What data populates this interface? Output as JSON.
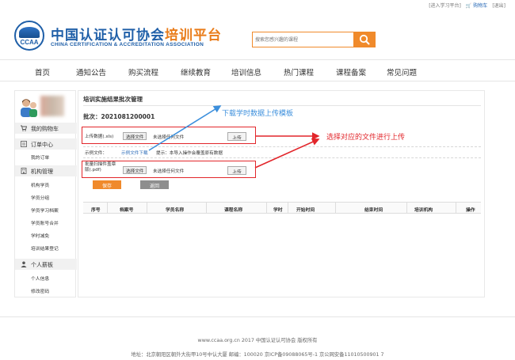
{
  "topbar": {
    "enter_learning": "[进入学习平台]",
    "cart": "购物车",
    "logout": "[退出]"
  },
  "header": {
    "logo_text": "CCAA",
    "brand_cn_main": "中国认证认可协会",
    "brand_cn_accent": "培训平台",
    "brand_en": "CHINA CERTIFICATION & ACCREDITATION ASSOCIATION",
    "search_placeholder": "搜索您感兴趣的课程"
  },
  "nav": [
    "首页",
    "通知公告",
    "购买流程",
    "继续教育",
    "培训信息",
    "热门课程",
    "课程备案",
    "常见问题"
  ],
  "sidebar": {
    "sections": [
      {
        "title": "我的购物车",
        "icon": "cart-icon",
        "items": []
      },
      {
        "title": "订单中心",
        "icon": "list-icon",
        "items": [
          "我的订单"
        ]
      },
      {
        "title": "机构管理",
        "icon": "building-icon",
        "items": [
          "机构学员",
          "学员分组",
          "学员学习档案",
          "学员账号合并",
          "学时减免",
          "培训结果登记"
        ]
      },
      {
        "title": "个人薪板",
        "icon": "person-icon",
        "items": [
          "个人信息",
          "修改密码"
        ]
      }
    ]
  },
  "main": {
    "page_title": "培训实施结果批次管理",
    "batch": "批次：2021081200001",
    "upload_data_label": "上传数据(.xls)",
    "choose_file": "选择文件",
    "no_file": "未选择任何文件",
    "upload": "上传",
    "sample_label": "示例文件：",
    "sample_link": "示例文件下载",
    "tip": "提示：本导入操作会覆盖原有数据",
    "stamp_label_1": "批量扫描件盖章",
    "stamp_label_2": "版(.pdf)",
    "save": "保存",
    "back": "返回",
    "table_headers": [
      "序号",
      "档案号",
      "学员名称",
      "课程名称",
      "学时",
      "开始时间",
      "结束时间",
      "培训机构",
      "操作"
    ]
  },
  "annotations": {
    "download_hint": "下载学时数据上传模板",
    "upload_hint": "选择对应的文件进行上传"
  },
  "footer": {
    "line1": "www.ccaa.org.cn   2017   中国认证认可协会   版权所有",
    "line2": "地址：北京朝阳区朝外大街甲10号中认大厦   邮编：100020   京ICP备09088065号-1   京公网安备11010500901 7"
  },
  "colors": {
    "brand_blue": "#1f5fa8",
    "accent_orange": "#f08a2b",
    "annotation_red": "#e2262b",
    "annotation_blue": "#3c8fdc"
  }
}
